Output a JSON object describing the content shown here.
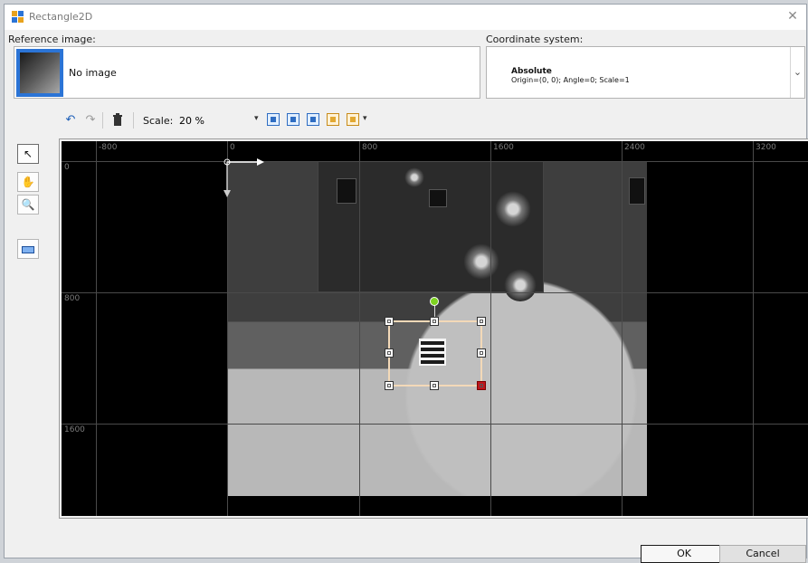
{
  "window": {
    "title": "Rectangle2D",
    "close_glyph": "✕"
  },
  "reference": {
    "label": "Reference image:",
    "value": "No image",
    "thumb_icon": "image-thumbnail-icon"
  },
  "coordinate": {
    "label": "Coordinate system:",
    "name": "Absolute",
    "detail": "Origin=(0, 0); Angle=0; Scale=1"
  },
  "toolbar": {
    "undo_icon": "undo-icon",
    "redo_icon": "redo-icon",
    "delete_icon": "trash-icon",
    "scale_label": "Scale:",
    "scale_value": "20 %",
    "zoom_icons": [
      "zoom-fit-icon",
      "zoom-fit-width-icon",
      "zoom-fit-height-icon",
      "zoom-actual-icon",
      "zoom-region-icon"
    ]
  },
  "side_tools": [
    {
      "name": "pointer-tool",
      "glyph": "↖"
    },
    {
      "name": "pan-tool",
      "glyph": "✋"
    },
    {
      "name": "zoom-tool",
      "glyph": "🔍"
    },
    {
      "name": "rectangle-tool",
      "glyph": ""
    }
  ],
  "rulers": {
    "x_labels": [
      "-800",
      "0",
      "800",
      "1600",
      "2400",
      "3200"
    ],
    "y_labels": [
      "0",
      "800",
      "1600"
    ]
  },
  "buttons": {
    "ok": "OK",
    "cancel": "Cancel"
  },
  "colors": {
    "selection_handle_active": "#c0141b",
    "rotation_handle": "#7ed321",
    "accent": "#2b74d6"
  }
}
